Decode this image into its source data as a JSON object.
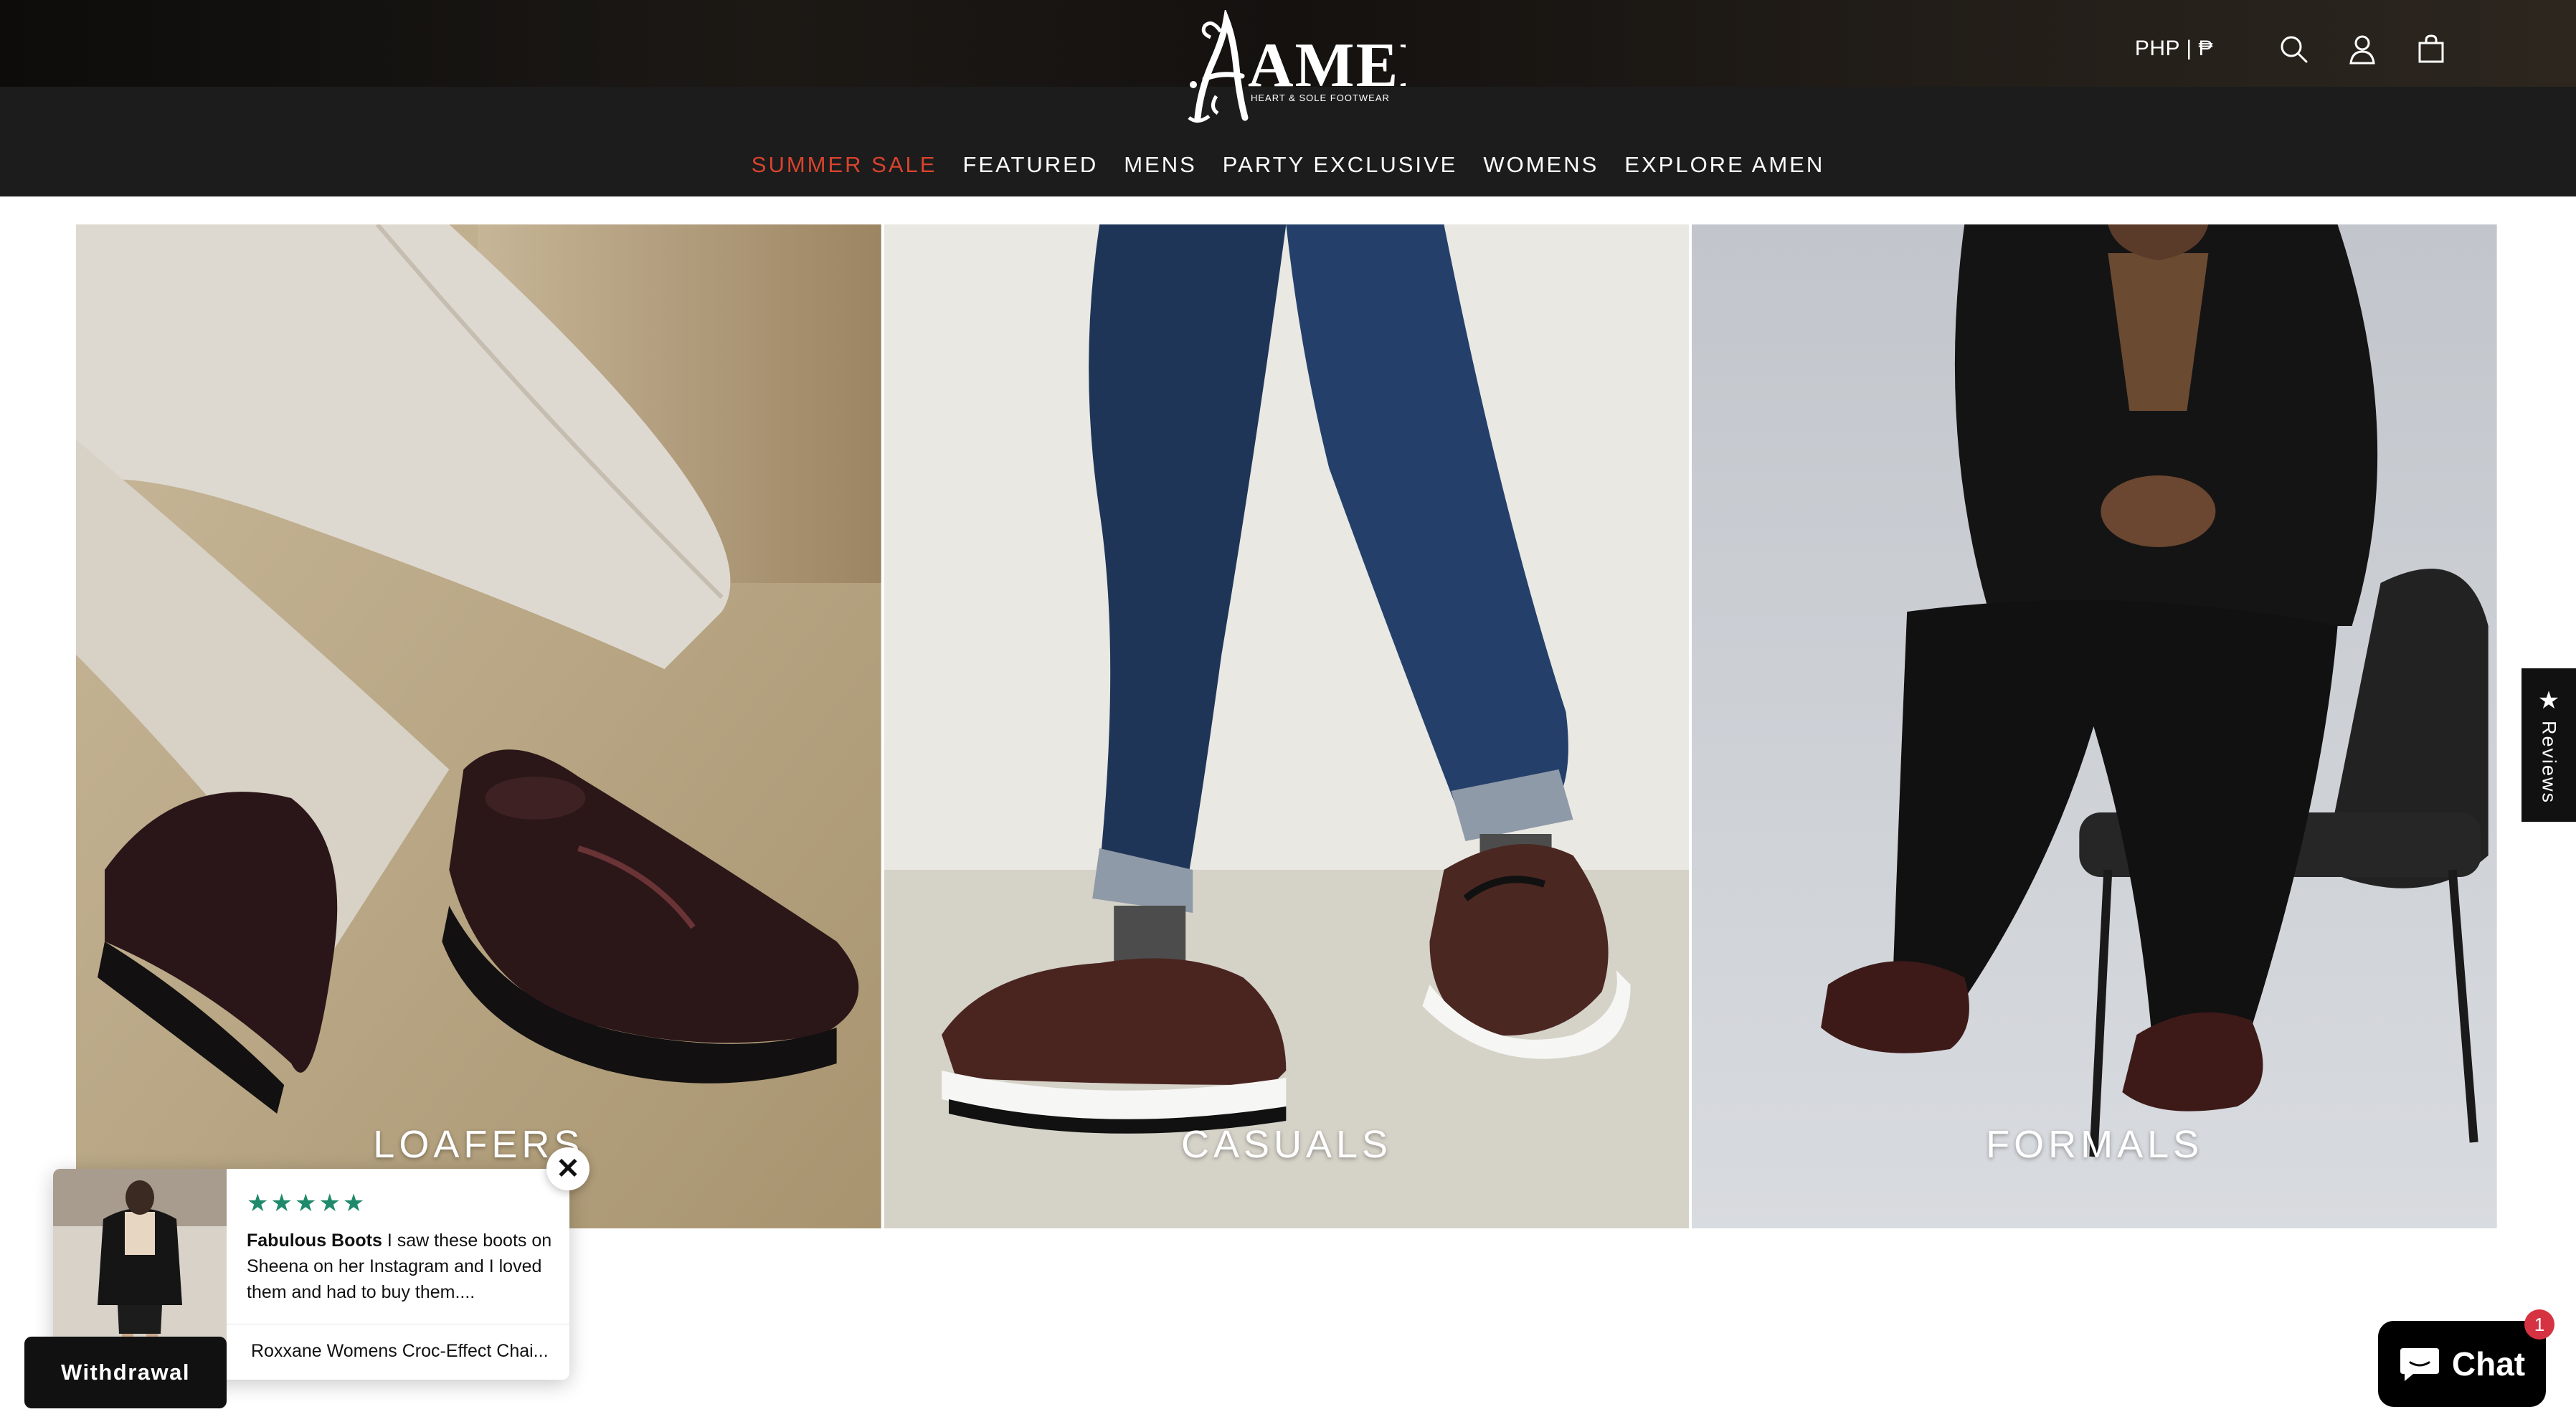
{
  "brand": {
    "logo_text": "AMEN",
    "tagline": "HEART & SOLE FOOTWEAR"
  },
  "header": {
    "currency": "PHP | ₱",
    "icons": [
      "search-icon",
      "account-icon",
      "cart-icon"
    ]
  },
  "nav": {
    "items": [
      {
        "label": "SUMMER SALE",
        "highlight": true
      },
      {
        "label": "FEATURED"
      },
      {
        "label": "MENS"
      },
      {
        "label": "PARTY EXCLUSIVE"
      },
      {
        "label": "WOMENS"
      },
      {
        "label": "EXPLORE AMEN"
      }
    ],
    "highlight_color": "#d9432e"
  },
  "categories": [
    {
      "label": "LOAFERS"
    },
    {
      "label": "CASUALS"
    },
    {
      "label": "FORMALS"
    }
  ],
  "reviews_tab": {
    "star": "★",
    "label": "Reviews"
  },
  "review_popup": {
    "stars": "★★★★★",
    "title": "Fabulous Boots",
    "text": "I saw these boots on Sheena on her Instagram and I loved them and had to buy them....",
    "product": "Roxxane Womens Croc-Effect Chai...",
    "close_symbol": "✕",
    "star_color": "#1e8a6b"
  },
  "withdrawal": {
    "label": "Withdrawal"
  },
  "chat": {
    "label": "Chat",
    "badge": "1"
  }
}
